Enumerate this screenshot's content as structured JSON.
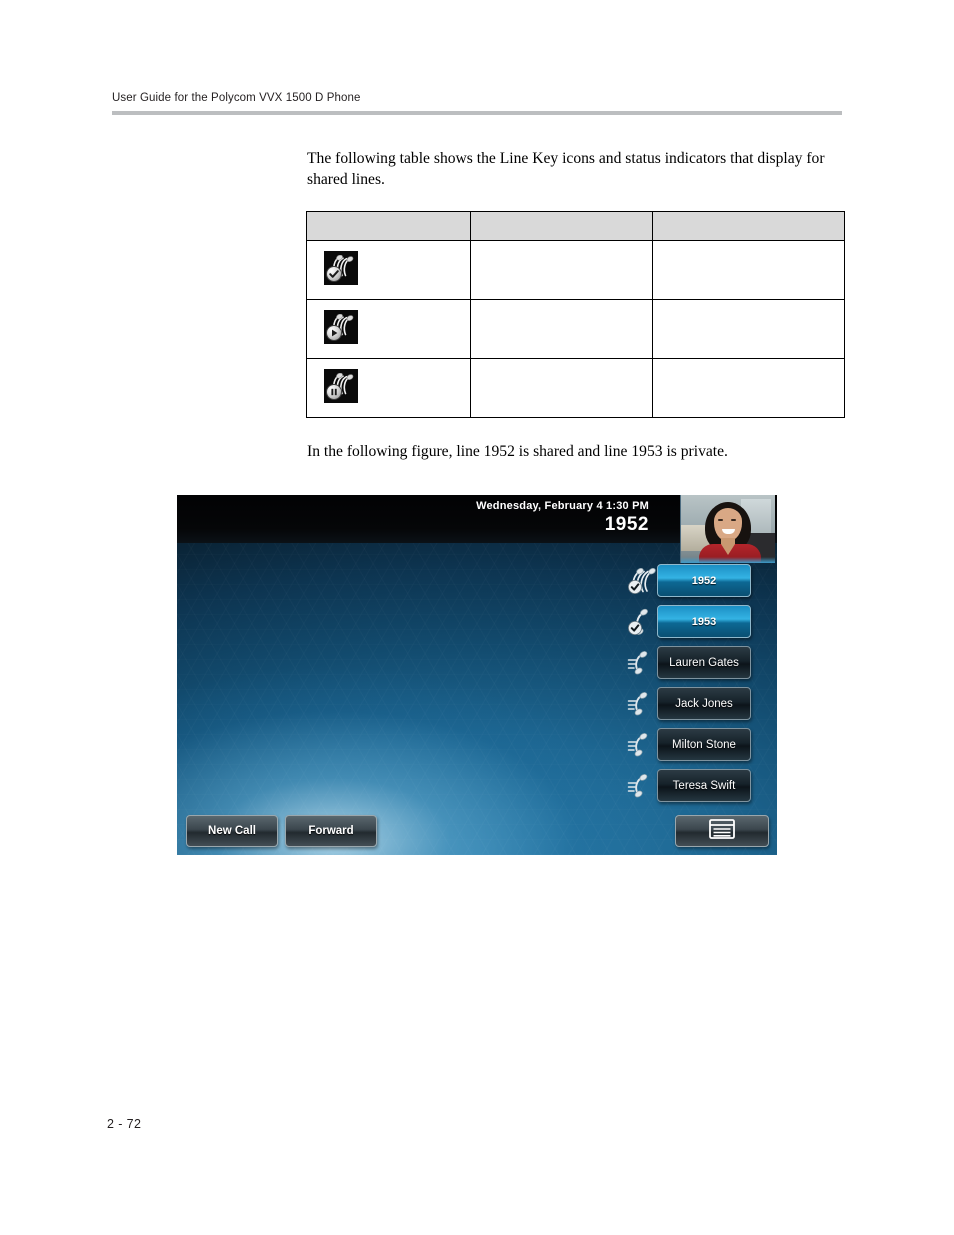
{
  "header": {
    "running_title": "User Guide for the Polycom VVX 1500 D Phone"
  },
  "body": {
    "intro_paragraph": "The following table shows the Line Key icons and status indicators that display for shared lines.",
    "figure_paragraph": "In the following figure, line 1952 is shared and line 1953 is private."
  },
  "table": {
    "columns": [
      {
        "header": "",
        "name": "icon-column"
      },
      {
        "header": "",
        "name": "middle-column"
      },
      {
        "header": "",
        "name": "right-column"
      }
    ],
    "rows": [
      {
        "icon": "shared-line-available-icon",
        "badge": "check",
        "middle": "",
        "right": ""
      },
      {
        "icon": "shared-line-active-icon",
        "badge": "play",
        "middle": "",
        "right": ""
      },
      {
        "icon": "shared-line-hold-icon",
        "badge": "pause",
        "middle": "",
        "right": ""
      }
    ]
  },
  "phone": {
    "status_bar": {
      "datetime": "Wednesday, February 4  1:30 PM",
      "line_number": "1952",
      "video_thumbnail_name": "video-self-view"
    },
    "line_keys": [
      {
        "label": "1952",
        "icon": "shared-line-handset-icon",
        "state": "active"
      },
      {
        "label": "1953",
        "icon": "private-line-handset-icon",
        "state": "active"
      },
      {
        "label": "Lauren Gates",
        "icon": "speed-dial-handset-icon",
        "state": "idle"
      },
      {
        "label": "Jack Jones",
        "icon": "speed-dial-handset-icon",
        "state": "idle"
      },
      {
        "label": "Milton Stone",
        "icon": "speed-dial-handset-icon",
        "state": "idle"
      },
      {
        "label": "Teresa Swift",
        "icon": "speed-dial-handset-icon",
        "state": "idle"
      }
    ],
    "soft_keys": [
      {
        "label": "New Call",
        "name": "new-call-softkey"
      },
      {
        "label": "Forward",
        "name": "forward-softkey"
      }
    ],
    "menu_key": {
      "label": "",
      "icon": "menu-list-icon"
    }
  },
  "footer": {
    "page_number": "2 - 72"
  },
  "colors": {
    "header_rule": "#bcbec0",
    "table_header_fill": "#d9d9d9",
    "table_border": "#000000",
    "phone_accent_blue": "#34b3e4",
    "phone_background_blue": "#1d6691"
  }
}
